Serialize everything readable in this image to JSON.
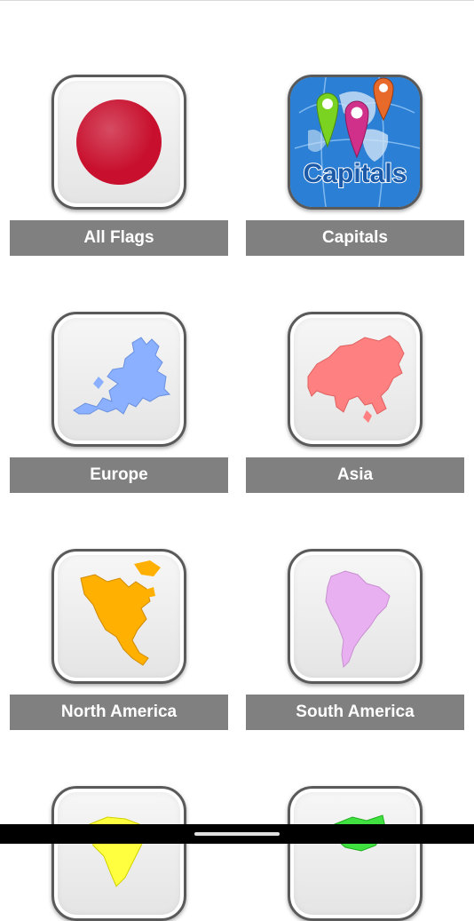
{
  "categories": [
    {
      "label": "All Flags",
      "icon": "japan-flag-icon"
    },
    {
      "label": "Capitals",
      "icon": "capitals-globe-icon",
      "icon_text": "Capitals"
    },
    {
      "label": "Europe",
      "icon": "europe-map-icon"
    },
    {
      "label": "Asia",
      "icon": "asia-map-icon"
    },
    {
      "label": "North America",
      "icon": "north-america-map-icon"
    },
    {
      "label": "South America",
      "icon": "south-america-map-icon"
    },
    {
      "label": "",
      "icon": "africa-map-icon"
    },
    {
      "label": "",
      "icon": "oceania-map-icon"
    }
  ],
  "colors": {
    "label_bg": "#808080",
    "japan_red": "#c8102e",
    "europe": "#8ab0ff",
    "asia": "#ff8080",
    "north_america": "#ffb000",
    "south_america": "#e8b0f0",
    "africa": "#ffff40",
    "oceania": "#40e040"
  }
}
